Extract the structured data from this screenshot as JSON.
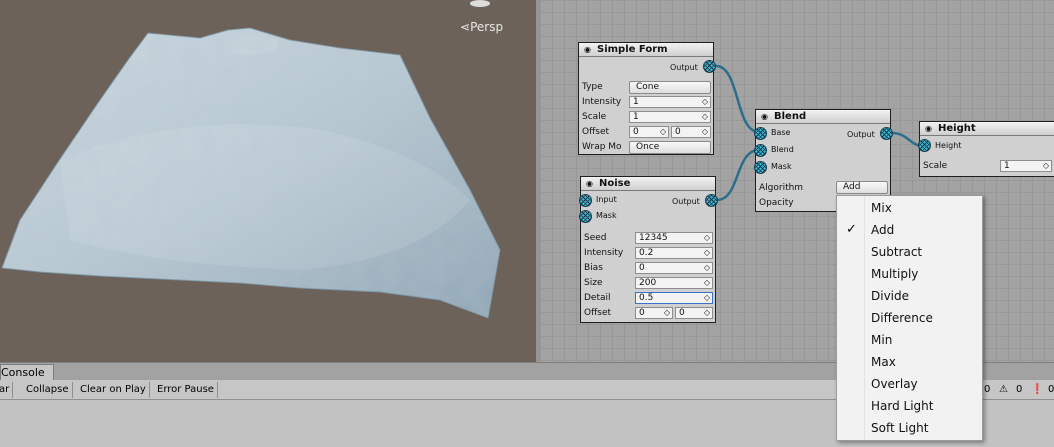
{
  "scene": {
    "view_label": "Persp"
  },
  "nodes": {
    "simple_form": {
      "title": "Simple Form",
      "output_label": "Output",
      "type_label": "Type",
      "type_value": "Cone",
      "intensity_label": "Intensity",
      "intensity_value": "1",
      "scale_label": "Scale",
      "scale_value": "1",
      "offset_label": "Offset",
      "offset_x": "0",
      "offset_y": "0",
      "wrap_label": "Wrap Mo",
      "wrap_value": "Once"
    },
    "noise": {
      "title": "Noise",
      "input_label": "Input",
      "mask_label": "Mask",
      "output_label": "Output",
      "seed_label": "Seed",
      "seed_value": "12345",
      "intensity_label": "Intensity",
      "intensity_value": "0.2",
      "bias_label": "Bias",
      "bias_value": "0",
      "size_label": "Size",
      "size_value": "200",
      "detail_label": "Detail",
      "detail_value": "0.5",
      "offset_label": "Offset",
      "offset_x": "0",
      "offset_y": "0"
    },
    "blend": {
      "title": "Blend",
      "base_label": "Base",
      "blend_label": "Blend",
      "mask_label": "Mask",
      "output_label": "Output",
      "algorithm_label": "Algorithm",
      "algorithm_value": "Add",
      "opacity_label": "Opacity"
    },
    "height": {
      "title": "Height",
      "height_label": "Height",
      "scale_label": "Scale",
      "scale_value": "1"
    }
  },
  "console": {
    "tab_label": "Console",
    "toolbar": {
      "clear": "ar",
      "collapse": "Collapse",
      "clear_on_play": "Clear on Play",
      "error_pause": "Error Pause"
    },
    "counts": {
      "log": "0",
      "warnings": "0",
      "errors": "0"
    }
  },
  "menu": {
    "selected": "Add",
    "items": [
      "Mix",
      "Add",
      "Subtract",
      "Multiply",
      "Divide",
      "Difference",
      "Min",
      "Max",
      "Overlay",
      "Hard Light",
      "Soft Light"
    ]
  },
  "colors": {
    "scene_bg": "#6c6259",
    "graph_bg": "#a3a3a3",
    "port": "#3fb8d6",
    "wire": "#2b6e8c",
    "terrain": "#b9c9d3"
  }
}
